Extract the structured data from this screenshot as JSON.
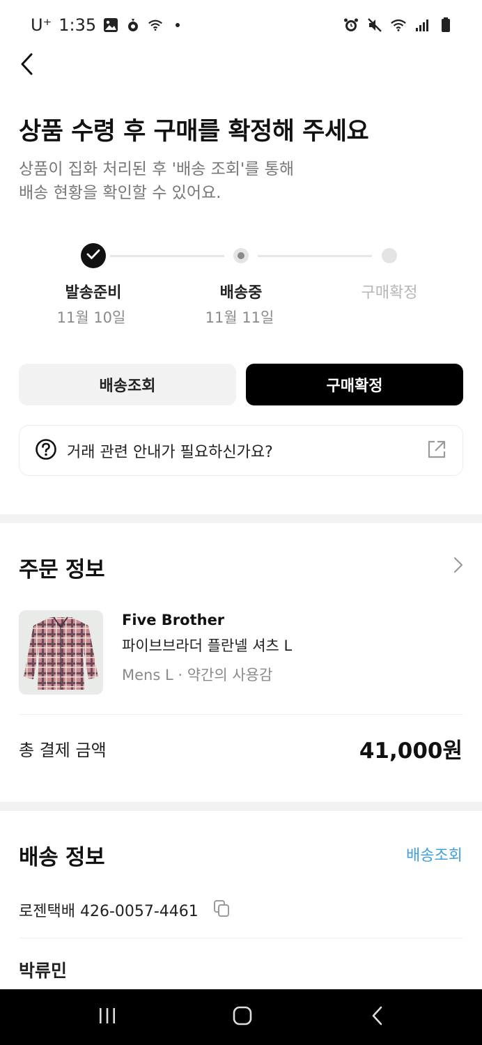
{
  "status_bar": {
    "carrier": "U⁺",
    "time": "1:35",
    "left_icons": [
      "gallery-icon",
      "tomato-icon",
      "wifi-call-icon",
      "dot-icon"
    ],
    "right_icons": [
      "alarm-icon",
      "mute-icon",
      "wifi-icon",
      "signal-icon",
      "battery-icon"
    ]
  },
  "header": {
    "back_icon": "chevron-left-icon"
  },
  "main": {
    "title": "상품 수령 후 구매를 확정해 주세요",
    "subtitle": "상품이 집화 처리된 후 '배송 조회'를 통해\n배송 현황을 확인할 수 있어요."
  },
  "stepper": {
    "steps": [
      {
        "label": "발송준비",
        "date": "11월 10일",
        "state": "done"
      },
      {
        "label": "배송중",
        "date": "11월 11일",
        "state": "current"
      },
      {
        "label": "구매확정",
        "date": "",
        "state": "pending"
      }
    ]
  },
  "actions": {
    "track_button": "배송조회",
    "confirm_button": "구매확정"
  },
  "guide": {
    "text": "거래 관련 안내가 필요하신가요?",
    "leading_icon": "question-circle-icon",
    "trailing_icon": "external-link-icon"
  },
  "order_info": {
    "title": "주문 정보",
    "product": {
      "brand": "Five Brother",
      "name": "파이브브라더 플란넬 셔츠 L",
      "option": "Mens L · 약간의 사용감"
    },
    "total_label": "총 결제 금액",
    "total_value": "41,000원"
  },
  "shipping_info": {
    "title": "배송 정보",
    "track_link": "배송조회",
    "tracking": "로젠택배 426-0057-4461",
    "recipient": "박류민"
  },
  "nav_bar": {
    "buttons": [
      "recents-icon",
      "home-icon",
      "back-icon"
    ]
  },
  "colors": {
    "primary": "#000000",
    "link": "#41a0dc",
    "muted": "#8a8a8a",
    "section_bg": "#f2f2f2"
  }
}
